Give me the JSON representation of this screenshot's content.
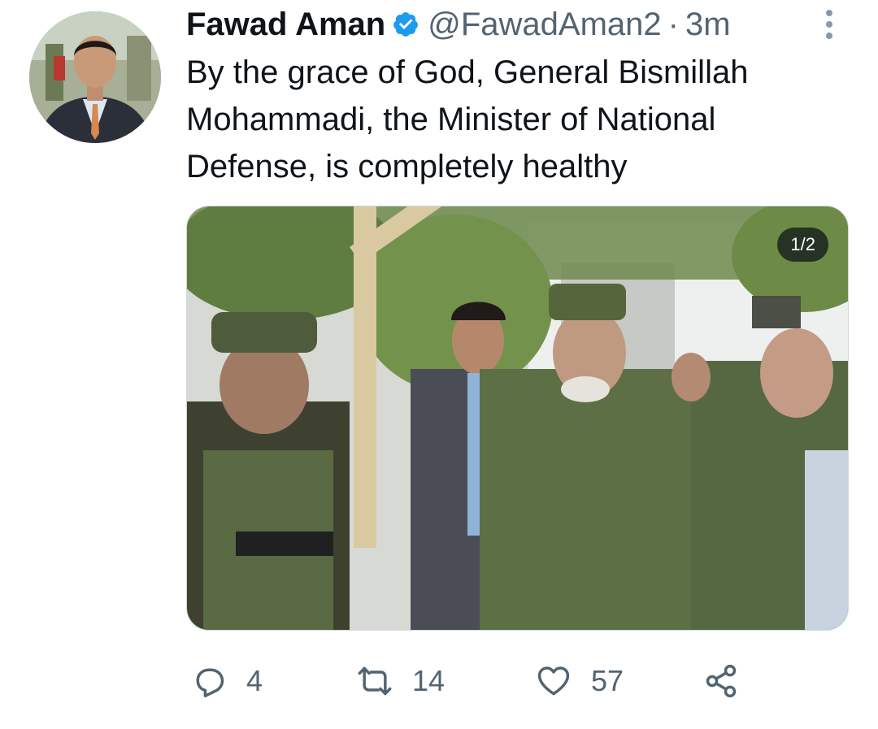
{
  "tweet": {
    "author_name": "Fawad Aman",
    "handle": "@FawadAman2",
    "separator": "·",
    "time": "3m",
    "text": "By the grace of God, General Bismillah\nMohammadi, the Minister of National\nDefense, is completely healthy",
    "verified": true
  },
  "media": {
    "counter": "1/2"
  },
  "actions": {
    "replies": "4",
    "retweets": "14",
    "likes": "57"
  },
  "icons": {
    "verified": "verified-badge-icon",
    "more": "more-options-icon",
    "reply": "reply-icon",
    "retweet": "retweet-icon",
    "like": "heart-icon",
    "share": "share-icon"
  },
  "colors": {
    "verified": "#1d9bf0",
    "secondary_text": "#536471",
    "primary_text": "#0f1419"
  }
}
